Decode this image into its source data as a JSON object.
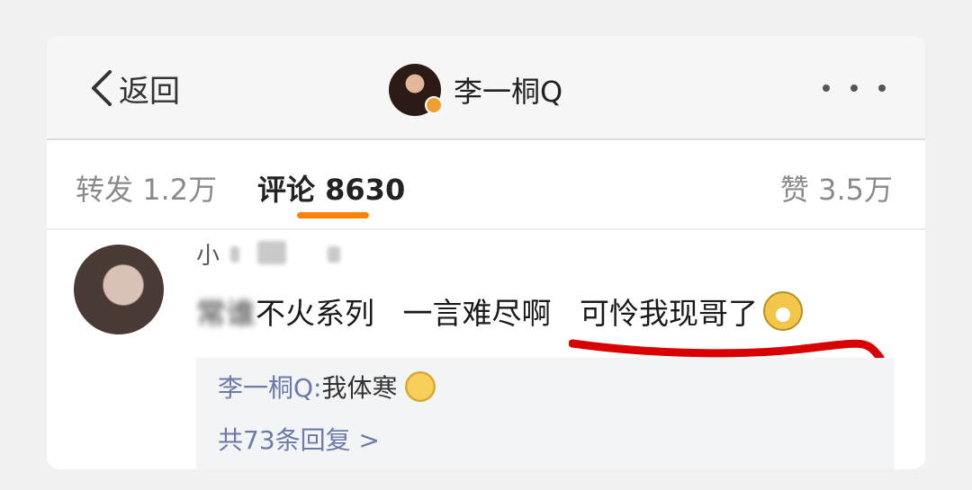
{
  "navbar": {
    "back_label": "返回",
    "profile_name": "李一桐Q"
  },
  "stats": {
    "repost": "转发 1.2万",
    "comments": "评论 8630",
    "likes": "赞 3.5万"
  },
  "comment": {
    "username": "小",
    "text_blurred": "常谁",
    "text_visible": "不火系列   一言难尽啊   可怜我现哥了",
    "emoji": "laughing-tears-emoji"
  },
  "reply": {
    "author": "李一桐Q: ",
    "text": "我体寒",
    "emoji": "thinking-emoji",
    "count_label": "共73条回复 >"
  },
  "colors": {
    "accent_orange": "#ff8200",
    "link_blue": "#6b7aa8",
    "annotation_red": "#d90000"
  }
}
